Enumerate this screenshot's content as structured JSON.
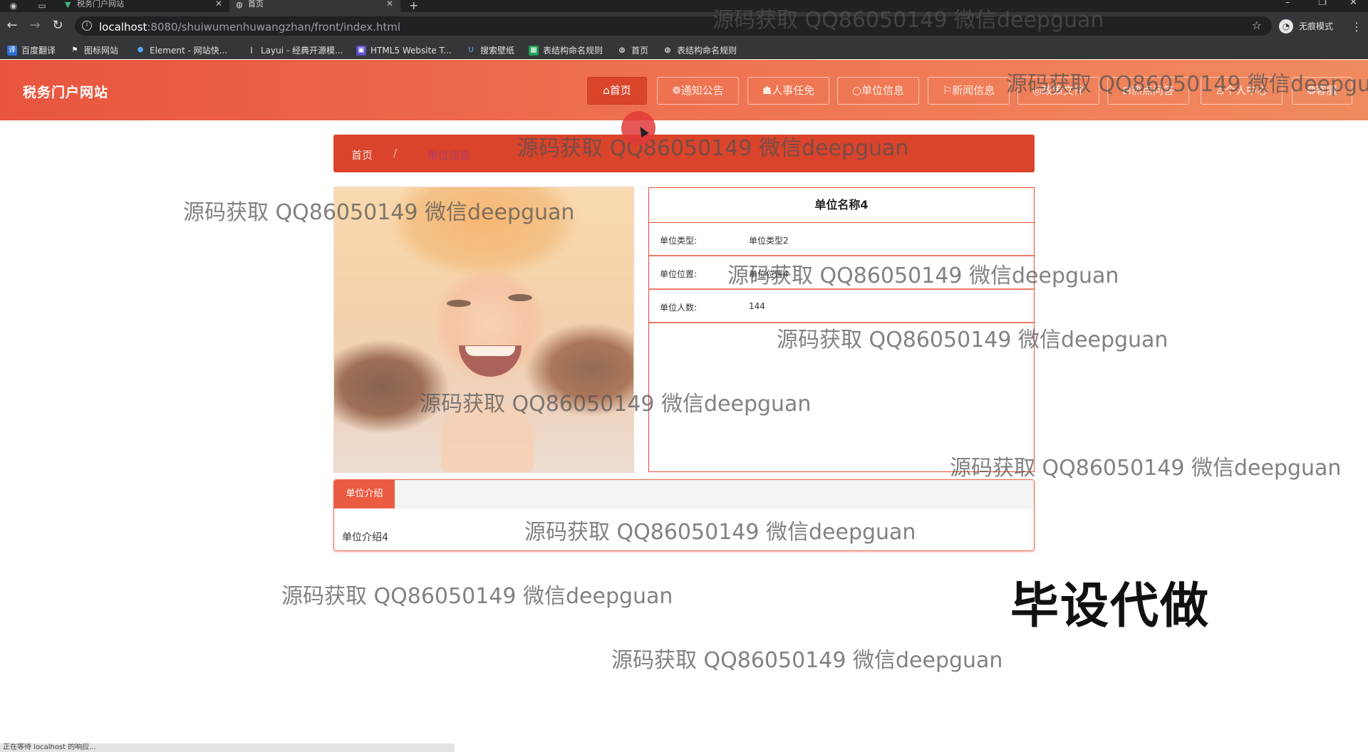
{
  "browser": {
    "tabs": [
      {
        "title": "税务门户网站",
        "favicon": "vue-icon"
      },
      {
        "title": "首页",
        "favicon": "globe-icon"
      }
    ],
    "new_tab_symbol": "+",
    "url_host": "localhost",
    "url_rest": ":8080/shuiwumenhuwangzhan/front/index.html",
    "incognito_label": "无痕模式",
    "bookmarks": [
      "百度翻译",
      "图标网站",
      "Element - 网站快...",
      "Layui - 经典开源模...",
      "HTML5 Website T...",
      "搜索壁纸",
      "表结构命名规则",
      "首页",
      "表结构命名规则"
    ]
  },
  "site": {
    "title": "税务门户网站",
    "nav": [
      {
        "label": "⌂首页",
        "active": true
      },
      {
        "label": "❁通知公告",
        "active": false
      },
      {
        "label": "☗人事任免",
        "active": false
      },
      {
        "label": "○单位信息",
        "active": false
      },
      {
        "label": "⚐新闻信息",
        "active": false
      },
      {
        "label": "◎政策文件",
        "active": false
      },
      {
        "label": "⊞热点问答",
        "active": false
      },
      {
        "label": "♙个人中心",
        "active": false
      },
      {
        "label": "❂客服",
        "active": false
      }
    ]
  },
  "breadcrumb": {
    "home": "首页",
    "separator": "/",
    "current": "单位信息"
  },
  "detail": {
    "name": "单位名称4",
    "fields": [
      {
        "label": "单位类型:",
        "value": "单位类型2"
      },
      {
        "label": "单位位置:",
        "value": "单位位置4"
      },
      {
        "label": "单位人数:",
        "value": "144"
      }
    ]
  },
  "intro": {
    "tab_label": "单位介绍",
    "text": "单位介绍4"
  },
  "overlay": {
    "watermark": "源码获取 QQ86050149 微信deepguan",
    "caption": "毕设代做"
  },
  "status_text": "正在等待 localhost 的响应..."
}
